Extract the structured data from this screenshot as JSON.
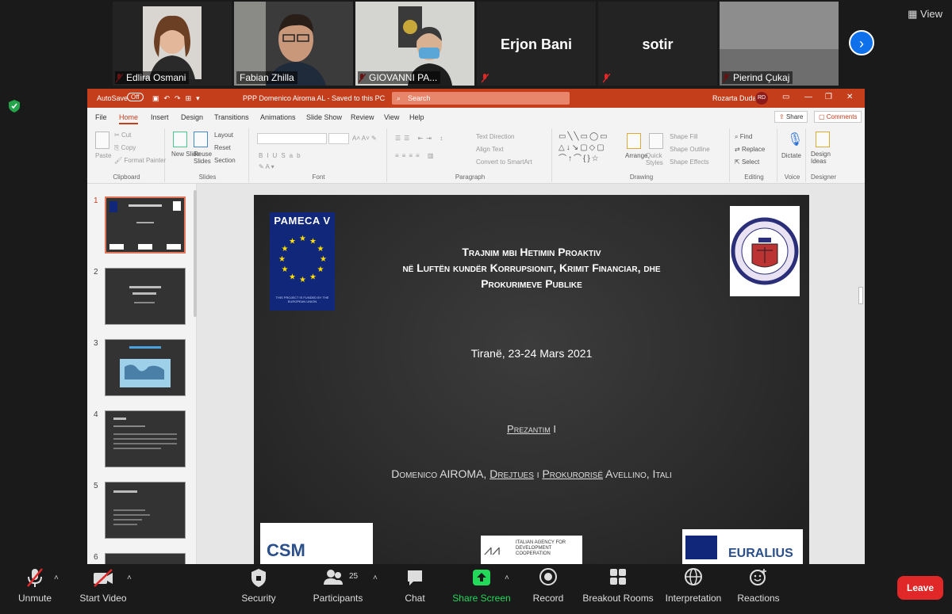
{
  "participants": [
    {
      "name": "Edlira Osmani",
      "muted": true
    },
    {
      "name": "Fabian Zhilla",
      "muted": false
    },
    {
      "name": "GIOVANNI PA...",
      "muted": true
    },
    {
      "name": "Erjon Bani",
      "muted": true
    },
    {
      "name": "sotir",
      "muted": true
    },
    {
      "name": "Pierind Çukaj",
      "muted": true
    }
  ],
  "view_label": "View",
  "ppt": {
    "autosave": "AutoSave",
    "autosave_state": "Off",
    "file_title": "PPP Domenico Airoma AL - Saved to this PC",
    "search_placeholder": "Search",
    "user_name": "Rozarta Duda",
    "user_initials": "RD",
    "menu": [
      "File",
      "Home",
      "Insert",
      "Design",
      "Transitions",
      "Animations",
      "Slide Show",
      "Review",
      "View",
      "Help"
    ],
    "active_menu": "Home",
    "share_label": "Share",
    "comments_label": "Comments",
    "ribbon": {
      "clipboard": {
        "paste": "Paste",
        "cut": "Cut",
        "copy": "Copy",
        "format_painter": "Format Painter",
        "label": "Clipboard"
      },
      "slides": {
        "new_slide": "New Slide",
        "reuse_slides": "Reuse Slides",
        "layout": "Layout",
        "reset": "Reset",
        "section": "Section",
        "label": "Slides"
      },
      "font": {
        "label": "Font"
      },
      "paragraph": {
        "text_direction": "Text Direction",
        "align_text": "Align Text",
        "convert_smartart": "Convert to SmartArt",
        "label": "Paragraph"
      },
      "drawing": {
        "arrange": "Arrange",
        "quick_styles": "Quick Styles",
        "shape_fill": "Shape Fill",
        "shape_outline": "Shape Outline",
        "shape_effects": "Shape Effects",
        "label": "Drawing"
      },
      "editing": {
        "find": "Find",
        "replace": "Replace",
        "select": "Select",
        "label": "Editing"
      },
      "voice": {
        "dictate": "Dictate",
        "label": "Voice"
      },
      "designer": {
        "design_ideas": "Design Ideas",
        "label": "Designer"
      }
    },
    "thumbnails": [
      "1",
      "2",
      "3",
      "4",
      "5",
      "6"
    ],
    "slide": {
      "pameca_title": "PAMECA V",
      "pameca_footer": "THIS PROJECT IS FUNDED BY THE EUROPEAN UNION",
      "title_line1": "Trajnim mbi Hetimin Proaktiv",
      "title_line2": "në Luftën kundër Korrupsionit, Krimit Financiar, dhe",
      "title_line3": "Prokurimeve Publike",
      "date": "Tiranë, 23-24 Mars 2021",
      "presentation": "Prezantim",
      "presentation_suffix": "I",
      "author_name": "Domenico AIROMA, ",
      "author_role1": "Drejtues",
      "author_mid": " i ",
      "author_role2": "Prokurorisë",
      "author_end": " Avellino, Itali",
      "logo_csm": "CSM",
      "logo_aics": "ITALIAN AGENCY FOR DEVELOPMENT COOPERATION",
      "logo_euralius": "EURALIUS"
    }
  },
  "toolbar": {
    "unmute": "Unmute",
    "start_video": "Start Video",
    "security": "Security",
    "participants": "Participants",
    "participant_count": "25",
    "chat": "Chat",
    "share_screen": "Share Screen",
    "record": "Record",
    "breakout_rooms": "Breakout Rooms",
    "interpretation": "Interpretation",
    "reactions": "Reactions",
    "leave": "Leave"
  },
  "colors": {
    "ppt_accent": "#c43e1c",
    "zoom_blue": "#0e71eb",
    "share_green": "#23d959",
    "leave_red": "#e02828",
    "mute_red": "#e02828"
  }
}
